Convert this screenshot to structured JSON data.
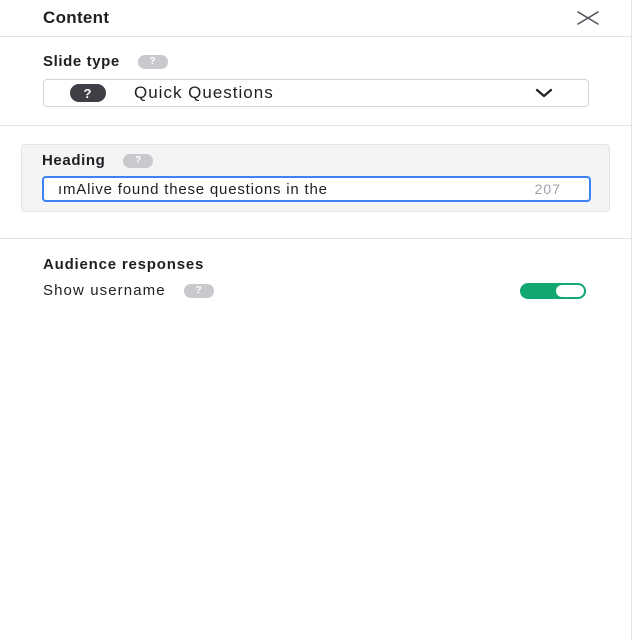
{
  "header": {
    "title": "Content",
    "close_icon": "close-icon"
  },
  "slide_type": {
    "label": "Slide type",
    "help_icon": "help-icon",
    "selected_icon": "question-icon",
    "selected_value": "Quick Questions",
    "dropdown_icon": "chevron-down-icon"
  },
  "heading": {
    "label": "Heading",
    "help_icon": "help-icon",
    "value": "ımAlive found these questions in the",
    "char_count": "207"
  },
  "audience": {
    "title": "Audience responses",
    "show_username_label": "Show username",
    "help_icon": "help-icon",
    "show_username_enabled": true
  },
  "colors": {
    "toggle_on": "#10a870",
    "focus_border": "#3b82f6",
    "help_badge": "#c9c9cd"
  }
}
